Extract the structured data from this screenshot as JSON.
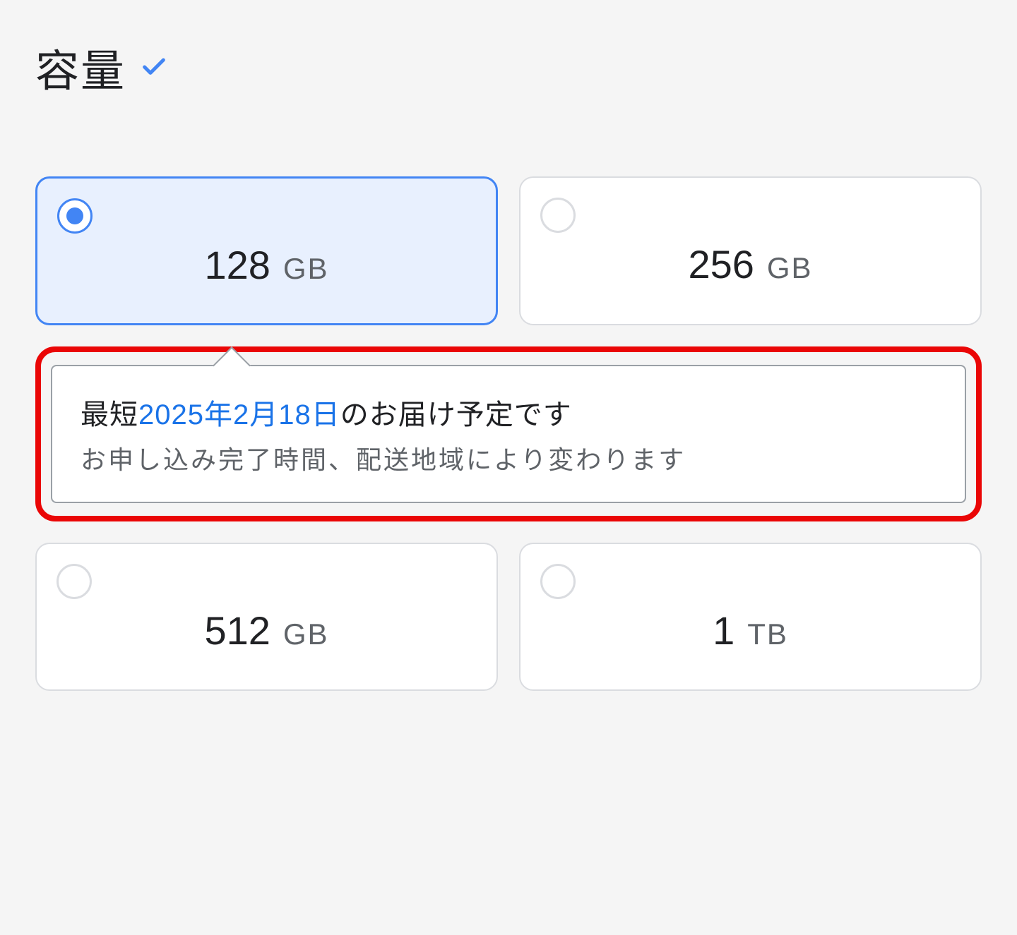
{
  "section": {
    "title": "容量"
  },
  "options": [
    {
      "value": "128",
      "unit": "GB",
      "selected": true
    },
    {
      "value": "256",
      "unit": "GB",
      "selected": false
    },
    {
      "value": "512",
      "unit": "GB",
      "selected": false
    },
    {
      "value": "1",
      "unit": "TB",
      "selected": false
    }
  ],
  "callout": {
    "prefix": "最短",
    "date": "2025年2月18日",
    "suffix": "のお届け予定です",
    "note": "お申し込み完了時間、配送地域により変わります"
  },
  "colors": {
    "accent": "#4285f4",
    "link": "#1a73e8",
    "highlight_border": "#ea0606"
  }
}
